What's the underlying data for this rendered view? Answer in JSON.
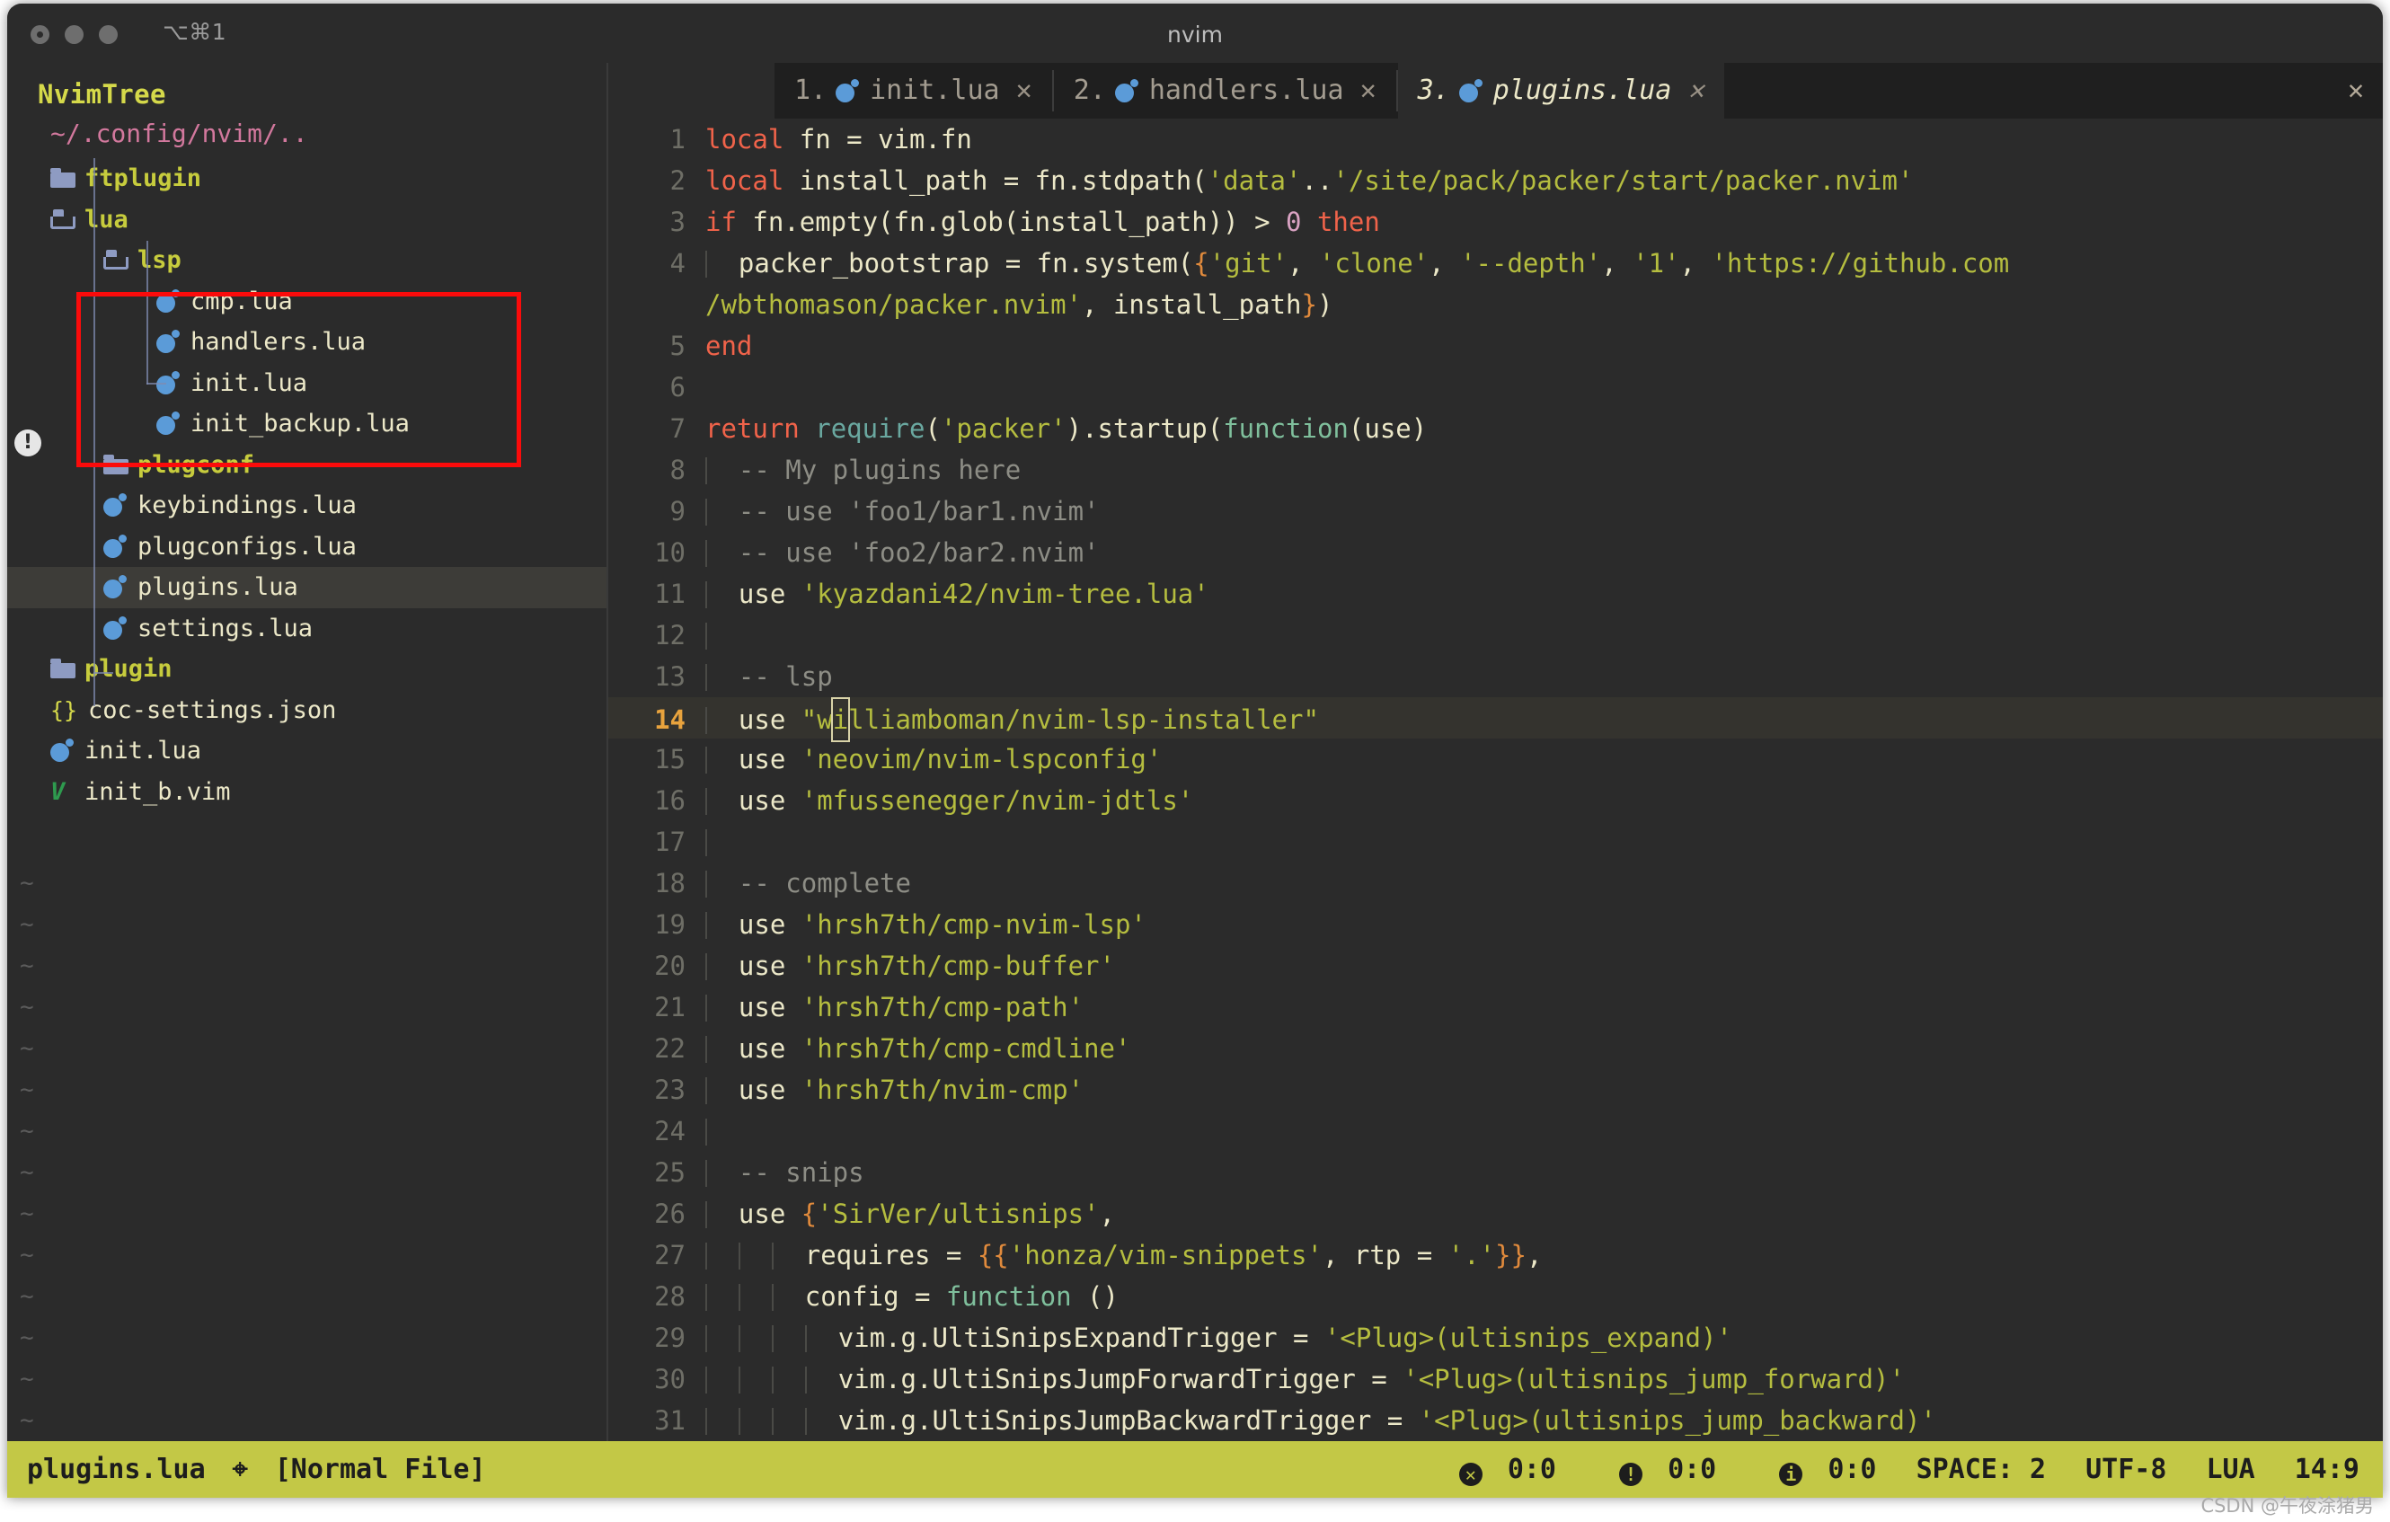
{
  "window": {
    "title": "nvim",
    "shortcut_hint": "⌥⌘1",
    "close_icon": "✕"
  },
  "sidebar": {
    "title": "NvimTree",
    "root_path": "~/.config/nvim/..",
    "diagnostic_badge": "!",
    "items": [
      {
        "label": "ftplugin",
        "type": "folder",
        "depth": 0,
        "selected": false
      },
      {
        "label": "lua",
        "type": "folder-open",
        "depth": 0,
        "selected": false
      },
      {
        "label": "lsp",
        "type": "folder-open",
        "depth": 1,
        "selected": false
      },
      {
        "label": "cmp.lua",
        "type": "lua",
        "depth": 2,
        "selected": false
      },
      {
        "label": "handlers.lua",
        "type": "lua",
        "depth": 2,
        "selected": false
      },
      {
        "label": "init.lua",
        "type": "lua",
        "depth": 2,
        "selected": false
      },
      {
        "label": "init_backup.lua",
        "type": "lua",
        "depth": 2,
        "selected": false,
        "last": true
      },
      {
        "label": "plugconf",
        "type": "folder",
        "depth": 1,
        "selected": false
      },
      {
        "label": "keybindings.lua",
        "type": "lua",
        "depth": 1,
        "selected": false
      },
      {
        "label": "plugconfigs.lua",
        "type": "lua",
        "depth": 1,
        "selected": false
      },
      {
        "label": "plugins.lua",
        "type": "lua",
        "depth": 1,
        "selected": true
      },
      {
        "label": "settings.lua",
        "type": "lua",
        "depth": 1,
        "selected": false,
        "last": true
      },
      {
        "label": "plugin",
        "type": "folder",
        "depth": 0,
        "selected": false
      },
      {
        "label": "coc-settings.json",
        "type": "json",
        "depth": 0,
        "selected": false
      },
      {
        "label": "init.lua",
        "type": "lua",
        "depth": 0,
        "selected": false
      },
      {
        "label": "init_b.vim",
        "type": "vim",
        "depth": 0,
        "selected": false
      }
    ],
    "empty_marker": "~",
    "empty_rows": 14
  },
  "tabs": [
    {
      "num": "1.",
      "label": "init.lua",
      "close": "✕",
      "active": false
    },
    {
      "num": "2.",
      "label": "handlers.lua",
      "close": "✕",
      "active": false
    },
    {
      "num": "3.",
      "label": "plugins.lua",
      "close": "✕",
      "active": true
    }
  ],
  "code": {
    "lines": [
      {
        "n": "1",
        "indent": 0,
        "tokens": [
          {
            "t": "local",
            "c": "kw"
          },
          {
            "t": " fn = vim.fn",
            "c": "pl"
          }
        ]
      },
      {
        "n": "2",
        "indent": 0,
        "tokens": [
          {
            "t": "local",
            "c": "kw"
          },
          {
            "t": " install_path = fn.stdpath(",
            "c": "pl"
          },
          {
            "t": "'data'",
            "c": "str"
          },
          {
            "t": "..",
            "c": "pl"
          },
          {
            "t": "'/site/pack/packer/start/packer.nvim'",
            "c": "str"
          }
        ]
      },
      {
        "n": "3",
        "indent": 0,
        "tokens": [
          {
            "t": "if",
            "c": "kw"
          },
          {
            "t": " fn.empty(fn.glob(install_path)) > ",
            "c": "pl"
          },
          {
            "t": "0",
            "c": "num2"
          },
          {
            "t": " ",
            "c": "pl"
          },
          {
            "t": "then",
            "c": "kw"
          }
        ]
      },
      {
        "n": "4",
        "indent": 1,
        "tokens": [
          {
            "t": "packer_bootstrap = fn.system(",
            "c": "pl"
          },
          {
            "t": "{",
            "c": "br"
          },
          {
            "t": "'git'",
            "c": "str"
          },
          {
            "t": ", ",
            "c": "pl"
          },
          {
            "t": "'clone'",
            "c": "str"
          },
          {
            "t": ", ",
            "c": "pl"
          },
          {
            "t": "'--depth'",
            "c": "str"
          },
          {
            "t": ", ",
            "c": "pl"
          },
          {
            "t": "'1'",
            "c": "str"
          },
          {
            "t": ", ",
            "c": "pl"
          },
          {
            "t": "'https://github.com",
            "c": "str"
          }
        ]
      },
      {
        "n": "",
        "indent": 0,
        "wrap": true,
        "tokens": [
          {
            "t": "/wbthomason/packer.nvim'",
            "c": "str"
          },
          {
            "t": ", install_path",
            "c": "pl"
          },
          {
            "t": "}",
            "c": "br"
          },
          {
            "t": ")",
            "c": "pl"
          }
        ]
      },
      {
        "n": "5",
        "indent": 0,
        "tokens": [
          {
            "t": "end",
            "c": "kw"
          }
        ]
      },
      {
        "n": "6",
        "indent": 0,
        "tokens": []
      },
      {
        "n": "7",
        "indent": 0,
        "tokens": [
          {
            "t": "return",
            "c": "kw"
          },
          {
            "t": " ",
            "c": "pl"
          },
          {
            "t": "require",
            "c": "req"
          },
          {
            "t": "(",
            "c": "pl"
          },
          {
            "t": "'packer'",
            "c": "str"
          },
          {
            "t": ").startup(",
            "c": "pl"
          },
          {
            "t": "function",
            "c": "fn"
          },
          {
            "t": "(use)",
            "c": "pl"
          }
        ]
      },
      {
        "n": "8",
        "indent": 1,
        "tokens": [
          {
            "t": "-- My plugins here",
            "c": "cmt"
          }
        ]
      },
      {
        "n": "9",
        "indent": 1,
        "tokens": [
          {
            "t": "-- use 'foo1/bar1.nvim'",
            "c": "cmt"
          }
        ]
      },
      {
        "n": "10",
        "indent": 1,
        "tokens": [
          {
            "t": "-- use 'foo2/bar2.nvim'",
            "c": "cmt"
          }
        ]
      },
      {
        "n": "11",
        "indent": 1,
        "tokens": [
          {
            "t": "use ",
            "c": "pl"
          },
          {
            "t": "'kyazdani42/nvim-tree.lua'",
            "c": "str"
          }
        ]
      },
      {
        "n": "12",
        "indent": 1,
        "tokens": []
      },
      {
        "n": "13",
        "indent": 1,
        "tokens": [
          {
            "t": "-- lsp",
            "c": "cmt"
          }
        ]
      },
      {
        "n": "14",
        "indent": 1,
        "current": true,
        "tokens": [
          {
            "t": "use ",
            "c": "pl"
          },
          {
            "t": "\"w",
            "c": "str"
          },
          {
            "t": "i",
            "c": "str",
            "cursor": true
          },
          {
            "t": "lliamboman/nvim-lsp-installer\"",
            "c": "str"
          }
        ]
      },
      {
        "n": "15",
        "indent": 1,
        "tokens": [
          {
            "t": "use ",
            "c": "pl"
          },
          {
            "t": "'neovim/nvim-lspconfig'",
            "c": "str"
          }
        ]
      },
      {
        "n": "16",
        "indent": 1,
        "tokens": [
          {
            "t": "use ",
            "c": "pl"
          },
          {
            "t": "'mfussenegger/nvim-jdtls'",
            "c": "str"
          }
        ]
      },
      {
        "n": "17",
        "indent": 1,
        "tokens": []
      },
      {
        "n": "18",
        "indent": 1,
        "tokens": [
          {
            "t": "-- complete",
            "c": "cmt"
          }
        ]
      },
      {
        "n": "19",
        "indent": 1,
        "tokens": [
          {
            "t": "use ",
            "c": "pl"
          },
          {
            "t": "'hrsh7th/cmp-nvim-lsp'",
            "c": "str"
          }
        ]
      },
      {
        "n": "20",
        "indent": 1,
        "tokens": [
          {
            "t": "use ",
            "c": "pl"
          },
          {
            "t": "'hrsh7th/cmp-buffer'",
            "c": "str"
          }
        ]
      },
      {
        "n": "21",
        "indent": 1,
        "tokens": [
          {
            "t": "use ",
            "c": "pl"
          },
          {
            "t": "'hrsh7th/cmp-path'",
            "c": "str"
          }
        ]
      },
      {
        "n": "22",
        "indent": 1,
        "tokens": [
          {
            "t": "use ",
            "c": "pl"
          },
          {
            "t": "'hrsh7th/cmp-cmdline'",
            "c": "str"
          }
        ]
      },
      {
        "n": "23",
        "indent": 1,
        "tokens": [
          {
            "t": "use ",
            "c": "pl"
          },
          {
            "t": "'hrsh7th/nvim-cmp'",
            "c": "str"
          }
        ]
      },
      {
        "n": "24",
        "indent": 1,
        "tokens": []
      },
      {
        "n": "25",
        "indent": 1,
        "tokens": [
          {
            "t": "-- snips",
            "c": "cmt"
          }
        ]
      },
      {
        "n": "26",
        "indent": 1,
        "tokens": [
          {
            "t": "use ",
            "c": "pl"
          },
          {
            "t": "{",
            "c": "br"
          },
          {
            "t": "'SirVer/ultisnips'",
            "c": "str"
          },
          {
            "t": ",",
            "c": "pl"
          }
        ]
      },
      {
        "n": "27",
        "indent": 3,
        "tokens": [
          {
            "t": "requires = ",
            "c": "pl"
          },
          {
            "t": "{{",
            "c": "br"
          },
          {
            "t": "'honza/vim-snippets'",
            "c": "str"
          },
          {
            "t": ", rtp = ",
            "c": "pl"
          },
          {
            "t": "'.'",
            "c": "str"
          },
          {
            "t": "}}",
            "c": "br"
          },
          {
            "t": ",",
            "c": "pl"
          }
        ]
      },
      {
        "n": "28",
        "indent": 3,
        "tokens": [
          {
            "t": "config = ",
            "c": "pl"
          },
          {
            "t": "function",
            "c": "fn"
          },
          {
            "t": " ()",
            "c": "pl"
          }
        ]
      },
      {
        "n": "29",
        "indent": 4,
        "tokens": [
          {
            "t": "vim.g.UltiSnipsExpandTrigger = ",
            "c": "pl"
          },
          {
            "t": "'<Plug>(ultisnips_expand)'",
            "c": "str"
          }
        ]
      },
      {
        "n": "30",
        "indent": 4,
        "tokens": [
          {
            "t": "vim.g.UltiSnipsJumpForwardTrigger = ",
            "c": "pl"
          },
          {
            "t": "'<Plug>(ultisnips_jump_forward)'",
            "c": "str"
          }
        ]
      },
      {
        "n": "31",
        "indent": 4,
        "tokens": [
          {
            "t": "vim.g.UltiSnipsJumpBackwardTrigger = ",
            "c": "pl"
          },
          {
            "t": "'<Plug>(ultisnips_jump_backward)'",
            "c": "str"
          }
        ]
      }
    ]
  },
  "statusbar": {
    "filename": "plugins.lua",
    "pin_icon": "⌖",
    "mode": "[Normal File]",
    "errors": "0:0",
    "warnings": "0:0",
    "info": "0:0",
    "indent": "SPACE: 2",
    "encoding": "UTF-8",
    "filetype": "LUA",
    "position": "14:9"
  },
  "watermark": "CSDN @午夜涂猪男",
  "colors": {
    "accent_status": "#c3c846",
    "dir": "#c7cc3d",
    "file": "#ece8c8",
    "keyword": "#f0634a",
    "string": "#b5bd3f",
    "comment": "#8d8d85",
    "highlight_box": "#fb0b0b",
    "bg": "#2b2b2b"
  }
}
